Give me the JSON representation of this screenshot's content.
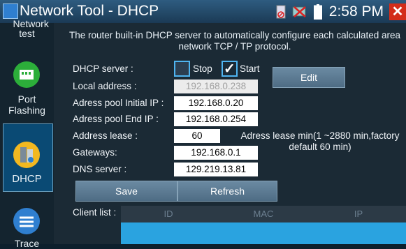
{
  "window": {
    "title": "Network Tool - DHCP",
    "time": "2:58 PM"
  },
  "sidebar": {
    "items": [
      {
        "label": "Network test",
        "icon": "network-test-icon"
      },
      {
        "label": "Port Flashing",
        "icon": "port-flashing-icon"
      },
      {
        "label": "DHCP",
        "icon": "dhcp-icon"
      },
      {
        "label": "Trace",
        "icon": "trace-icon"
      }
    ]
  },
  "main": {
    "description": "The router built-in DHCP server to automatically configure each calculated area network TCP / TP protocol.",
    "dhcp_server": {
      "label": "DHCP server :",
      "stop_label": "Stop",
      "start_label": "Start",
      "stop_checked": false,
      "start_checked": true
    },
    "edit_label": "Edit",
    "fields": [
      {
        "label": "Local address :",
        "value": "192.168.0.238"
      },
      {
        "label": "Adress pool Initial IP :",
        "value": "192.168.0.20"
      },
      {
        "label": "Adress pool End IP :",
        "value": "192.168.0.254"
      },
      {
        "label": "Address lease :",
        "value": "60"
      },
      {
        "label": "Gateways:",
        "value": "192.168.0.1"
      },
      {
        "label": "DNS server :",
        "value": "129.219.13.81"
      }
    ],
    "lease_note": "Adress lease min(1 ~2880 min,factory default 60 min)",
    "save_label": "Save",
    "refresh_label": "Refresh",
    "client_list_label": "Client list :",
    "client_table": {
      "columns": [
        "ID",
        "MAC",
        "IP"
      ]
    }
  },
  "colors": {
    "accent": "#2aa3e0",
    "close": "#d32d1a"
  }
}
